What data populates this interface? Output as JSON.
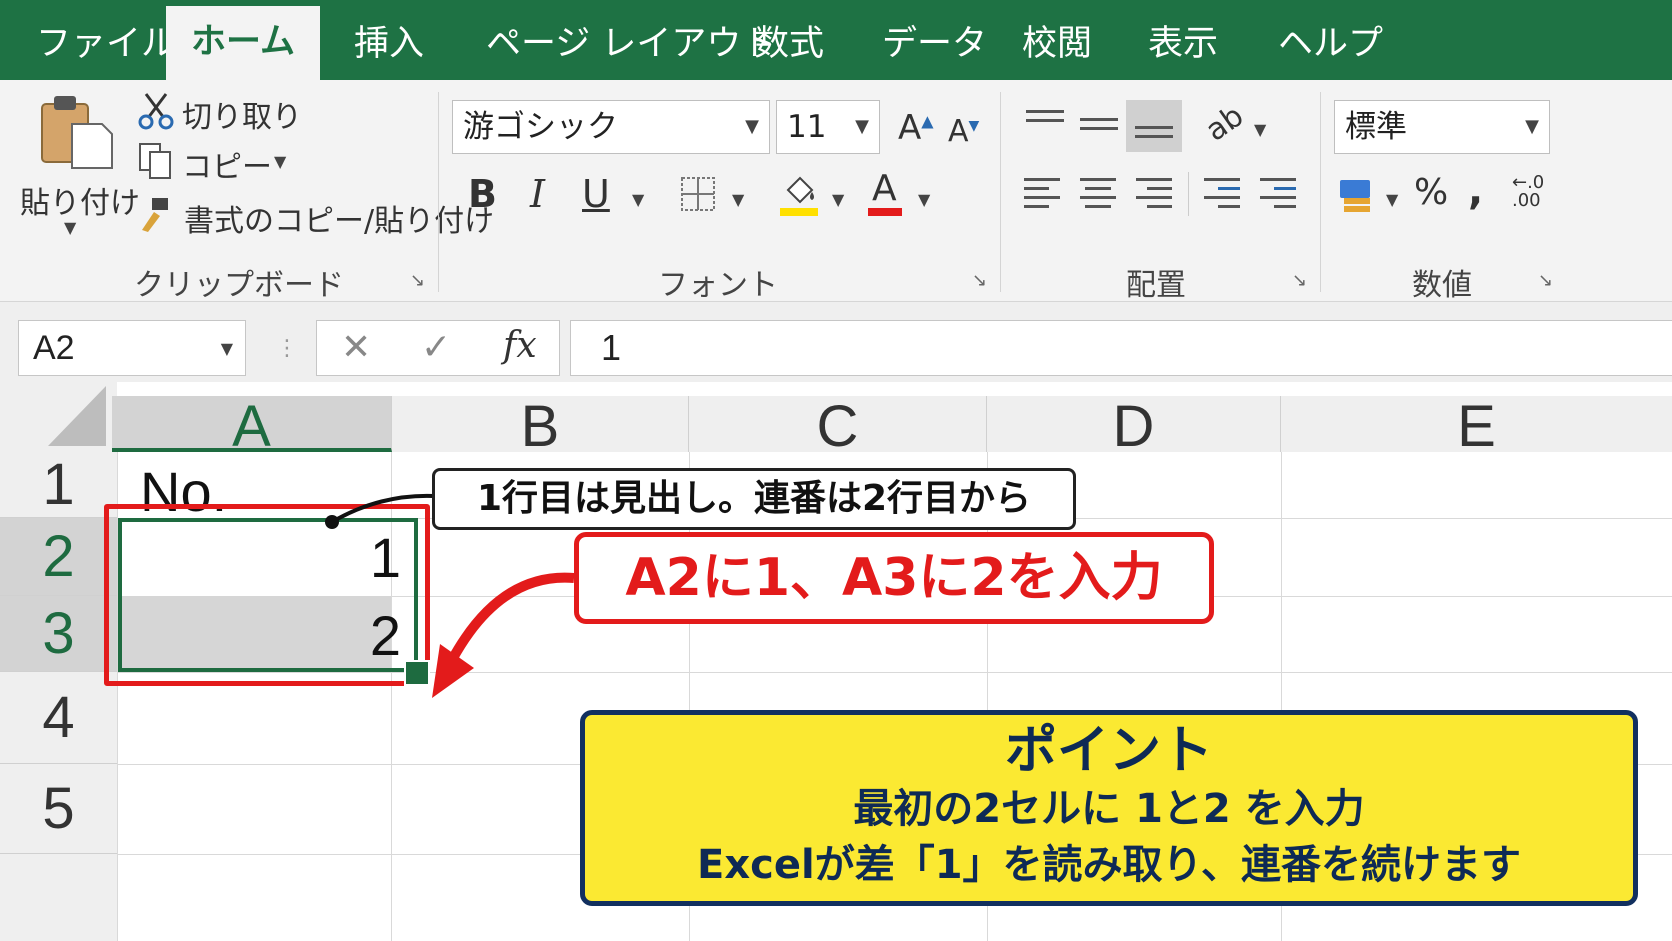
{
  "tabs": [
    "ファイル",
    "ホーム",
    "挿入",
    "ページ レイアウト",
    "数式",
    "データ",
    "校閲",
    "表示",
    "ヘルプ"
  ],
  "active_tab": "ホーム",
  "clipboard": {
    "paste_label": "貼り付け",
    "cut_label": "切り取り",
    "copy_label": "コピー",
    "format_painter_label": "書式のコピー/貼り付け",
    "group_label": "クリップボード"
  },
  "font": {
    "font_name": "游ゴシック",
    "font_size": "11",
    "bold": "B",
    "italic": "I",
    "underline": "U",
    "font_color_glyph": "A",
    "group_label": "フォント",
    "highlight_color": "#ffe000",
    "font_color": "#e31b1b"
  },
  "alignment": {
    "group_label": "配置"
  },
  "number": {
    "format": "標準",
    "percent": "%",
    "comma": ",",
    "decimal_increase": "←.0 .00",
    "group_label": "数値"
  },
  "formula_bar": {
    "name_box": "A2",
    "cancel": "✕",
    "enter": "✓",
    "fx": "fx",
    "content": "1"
  },
  "sheet": {
    "columns": [
      "A",
      "B",
      "C",
      "D",
      "E"
    ],
    "rows": [
      "1",
      "2",
      "3",
      "4",
      "5"
    ],
    "cells": {
      "A1": "No.",
      "A2": "1",
      "A3": "2"
    }
  },
  "annotations": {
    "header_note": "1行目は見出し。連番は2行目から",
    "input_note": "A2に1、A3に2を入力",
    "point_title": "ポイント",
    "point_line1": "最初の2セルに 1と2 を入力",
    "point_line2": "Excelが差「1」を読み取り、連番を続けます"
  },
  "colors": {
    "excel_green": "#1e7244",
    "annotation_red": "#e31b1b",
    "point_yellow": "#fbe932",
    "point_navy": "#12305f"
  }
}
